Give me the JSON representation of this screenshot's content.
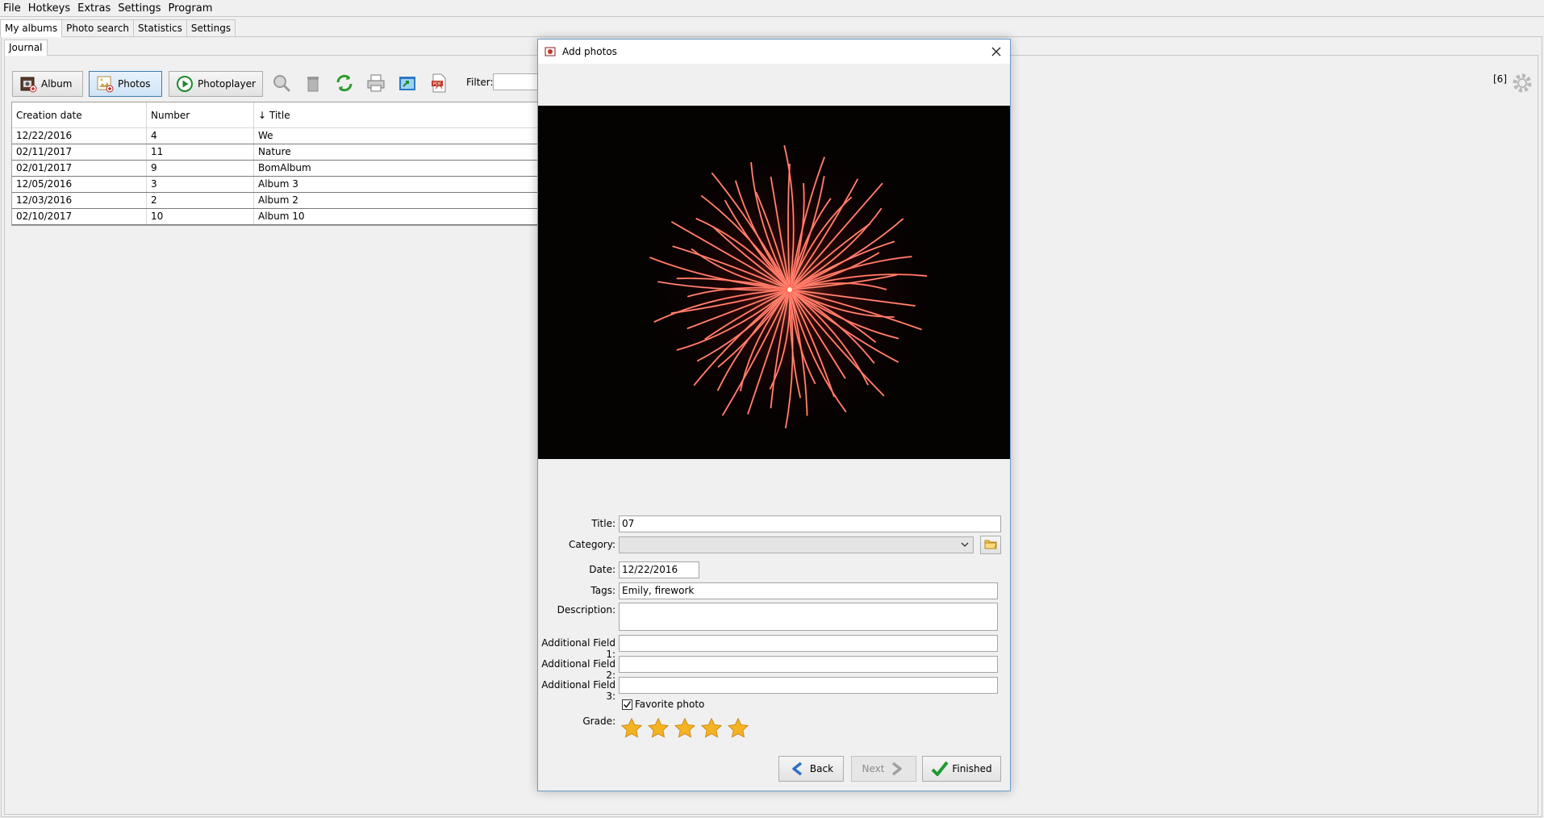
{
  "menu": [
    "File",
    "Hotkeys",
    "Extras",
    "Settings",
    "Program"
  ],
  "main_tabs": [
    "My albums",
    "Photo search",
    "Statistics",
    "Settings"
  ],
  "sub_tabs": [
    "Journal"
  ],
  "toolbar": {
    "album_label": "Album",
    "photos_label": "Photos",
    "photoplayer_label": "Photoplayer",
    "filter_label": "Filter:",
    "filter_value": "",
    "record_count": "[6]"
  },
  "table": {
    "columns": [
      "Creation date",
      "Number",
      "↓ Title"
    ],
    "rows": [
      [
        "12/22/2016",
        "4",
        "We"
      ],
      [
        "02/11/2017",
        "11",
        "Nature"
      ],
      [
        "02/01/2017",
        "9",
        "BomAlbum"
      ],
      [
        "12/05/2016",
        "3",
        "Album 3"
      ],
      [
        "12/03/2016",
        "2",
        "Album 2"
      ],
      [
        "02/10/2017",
        "10",
        "Album 10"
      ]
    ]
  },
  "dialog": {
    "title": "Add photos",
    "fields": {
      "title_label": "Title:",
      "title_value": "07",
      "category_label": "Category:",
      "category_value": "",
      "date_label": "Date:",
      "date_value": "12/22/2016",
      "tags_label": "Tags:",
      "tags_value": "Emily, firework",
      "description_label": "Description:",
      "description_value": "",
      "add1_label": "Additional Field 1:",
      "add1_value": "",
      "add2_label": "Additional Field 2:",
      "add2_value": "",
      "add3_label": "Additional Field 3:",
      "add3_value": "",
      "favorite_label": "Favorite photo",
      "favorite_checked": true,
      "grade_label": "Grade:",
      "grade_value": 5,
      "grade_max": 5
    },
    "buttons": {
      "back": "Back",
      "next": "Next",
      "finished": "Finished"
    }
  },
  "colors": {
    "selection_border": "#3c7fb1",
    "dialog_border": "#6a9dcc",
    "star": "#f5b324"
  }
}
